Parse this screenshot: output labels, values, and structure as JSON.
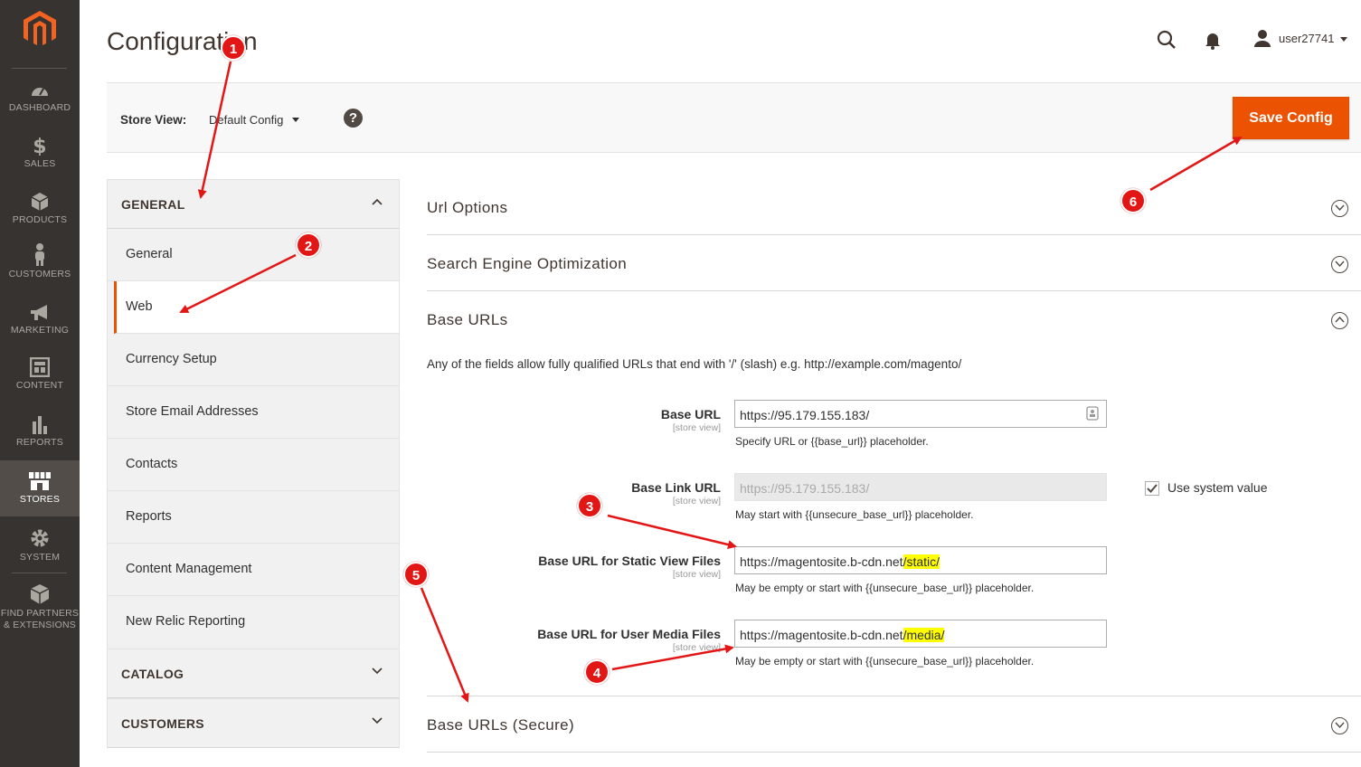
{
  "nav": {
    "items": [
      {
        "label": "DASHBOARD",
        "icon": "dashboard-icon"
      },
      {
        "label": "SALES",
        "icon": "dollar-icon"
      },
      {
        "label": "PRODUCTS",
        "icon": "cube-icon"
      },
      {
        "label": "CUSTOMERS",
        "icon": "person-icon"
      },
      {
        "label": "MARKETING",
        "icon": "megaphone-icon"
      },
      {
        "label": "CONTENT",
        "icon": "layout-icon"
      },
      {
        "label": "REPORTS",
        "icon": "bar-chart-icon"
      },
      {
        "label": "STORES",
        "icon": "storefront-icon",
        "active": true
      },
      {
        "label": "SYSTEM",
        "icon": "gear-icon"
      },
      {
        "label_line1": "FIND PARTNERS",
        "label_line2": "& EXTENSIONS",
        "icon": "extensions-icon"
      }
    ]
  },
  "header": {
    "title": "Configuration",
    "user": "user27741"
  },
  "store_bar": {
    "label": "Store View:",
    "value": "Default Config",
    "help": "?",
    "save_label": "Save Config"
  },
  "tabs": {
    "general_title": "GENERAL",
    "items": [
      "General",
      "Web",
      "Currency Setup",
      "Store Email Addresses",
      "Contacts",
      "Reports",
      "Content Management",
      "New Relic Reporting"
    ],
    "catalog_title": "CATALOG",
    "customers_title": "CUSTOMERS"
  },
  "sections": {
    "url_options": "Url Options",
    "seo": "Search Engine Optimization",
    "base_urls": "Base URLs",
    "base_urls_secure": "Base URLs (Secure)"
  },
  "base_urls": {
    "note": "Any of the fields allow fully qualified URLs that end with '/' (slash) e.g. http://example.com/magento/",
    "scope": "[store view]",
    "base_url": {
      "label": "Base URL",
      "value": "https://95.179.155.183/",
      "note": "Specify URL or {{base_url}} placeholder."
    },
    "base_link_url": {
      "label": "Base Link URL",
      "value": "https://95.179.155.183/",
      "note": "May start with {{unsecure_base_url}} placeholder.",
      "use_system": "Use system value"
    },
    "static_url": {
      "label": "Base URL for Static View Files",
      "value_prefix": "https://magentosite.b-cdn.net",
      "value_hl": "/static/",
      "note": "May be empty or start with {{unsecure_base_url}} placeholder."
    },
    "media_url": {
      "label": "Base URL for User Media Files",
      "value_prefix": "https://magentosite.b-cdn.net",
      "value_hl": "/media/",
      "note": "May be empty or start with {{unsecure_base_url}} placeholder."
    }
  },
  "annotations": {
    "badges": [
      "1",
      "2",
      "3",
      "4",
      "5",
      "6"
    ],
    "color": "#e31616"
  },
  "colors": {
    "accent": "#eb5202",
    "nav_bg": "#373330",
    "highlight": "#ffff00"
  }
}
